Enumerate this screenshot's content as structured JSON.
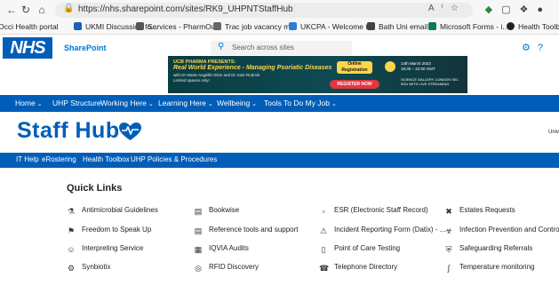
{
  "browser": {
    "url": "https://nhs.sharepoint.com/sites/RK9_UHPNTStaffHub",
    "icons": [
      "back-icon",
      "refresh-icon",
      "home-icon",
      "lock-icon",
      "read-aloud-icon",
      "favorite-icon",
      "shield-icon",
      "extension-icon",
      "collections-icon",
      "profile-icon"
    ]
  },
  "bookmarks": [
    {
      "label": "Occi Health portal",
      "color": "#1e5fb8"
    },
    {
      "label": "UKMI Discussion fo...",
      "color": "#1e5fb8"
    },
    {
      "label": "Services - PharmOu...",
      "color": "#555555"
    },
    {
      "label": "Trac job vacancy m...",
      "color": "#666666"
    },
    {
      "label": "UKCPA - Welcome t...",
      "color": "#2d7fd3"
    },
    {
      "label": "Bath Uni email",
      "color": "#444444"
    },
    {
      "label": "Microsoft Forms - i...",
      "color": "#0e7a5c"
    },
    {
      "label": "Health Toolbox",
      "color": "#222222"
    }
  ],
  "sharepoint": {
    "logo": "NHS",
    "site_label": "SharePoint",
    "search_placeholder": "Search across sites"
  },
  "banner": {
    "line1": "UCB PHARMA PRESENTS:",
    "line2": "Real World Experience - Managing Psoriatic Diseases",
    "line3": "with Dr Maria-Angeliki Gkini and Dr Jose Rodrick",
    "line4": "Limited spaces only!",
    "online": "Online Registration",
    "register": "REGISTER NOW",
    "date": "14th March 2023",
    "time": "18:30 – 22:00 GMT",
    "venue": "SCIENCE GALLERY, LONDON SE1 9GU WITH LIVE STREAMING"
  },
  "topnav": [
    {
      "label": "Home",
      "dropdown": true
    },
    {
      "label": "UHP Structure",
      "dropdown": false
    },
    {
      "label": "Working Here",
      "dropdown": true
    },
    {
      "label": "Learning Here",
      "dropdown": true
    },
    {
      "label": "Wellbeing",
      "dropdown": true
    },
    {
      "label": "Tools To Do My Job",
      "dropdown": true
    }
  ],
  "hub": {
    "title": "Staff Hub",
    "right_text": "Univ"
  },
  "subnav": [
    "IT Help",
    "eRostering",
    "Health Toolbox",
    "UHP Policies & Procedures"
  ],
  "quick_links": {
    "title": "Quick Links",
    "items": [
      {
        "label": "Antimicrobial Guidelines",
        "icon": "flask-icon"
      },
      {
        "label": "Bookwise",
        "icon": "book-icon"
      },
      {
        "label": "ESR (Electronic Staff Record)",
        "icon": "document-icon"
      },
      {
        "label": "Estates Requests",
        "icon": "wrench-icon"
      },
      {
        "label": "Freedom to Speak Up",
        "icon": "megaphone-icon"
      },
      {
        "label": "Reference tools and support",
        "icon": "book-icon"
      },
      {
        "label": "Incident Reporting Form (Datix) - ...",
        "icon": "alert-icon"
      },
      {
        "label": "Infection Prevention and Control",
        "icon": "biohazard-icon"
      },
      {
        "label": "Interpreting Service",
        "icon": "translate-icon"
      },
      {
        "label": "IQVIA Audits",
        "icon": "chart-icon"
      },
      {
        "label": "Point of Care Testing",
        "icon": "test-icon"
      },
      {
        "label": "Safeguarding Referrals",
        "icon": "shield-person-icon"
      },
      {
        "label": "Synbiotix",
        "icon": "gear-icon"
      },
      {
        "label": "RFID Discovery",
        "icon": "rfid-icon"
      },
      {
        "label": "Telephone Directory",
        "icon": "phone-icon"
      },
      {
        "label": "Temperature monitoring",
        "icon": "thermometer-icon"
      }
    ]
  },
  "colors": {
    "nhs_blue": "#005eb8",
    "sharepoint_blue": "#0078d4",
    "banner_bg": "#0e4a52",
    "banner_accent": "#ffd54a",
    "register_red": "#e3363f"
  }
}
